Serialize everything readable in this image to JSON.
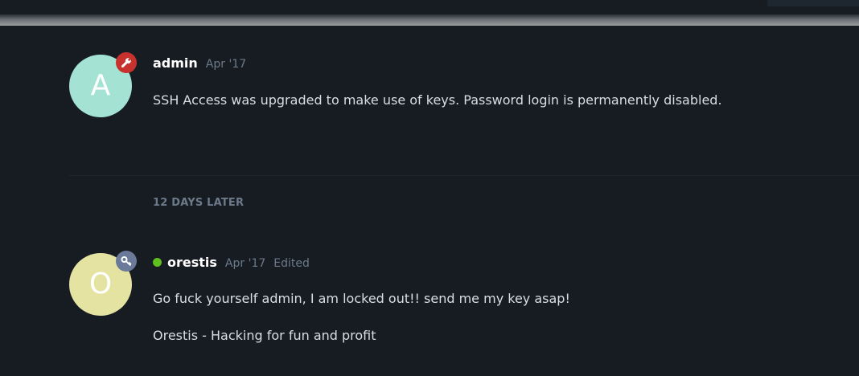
{
  "posts": [
    {
      "avatar_letter": "A",
      "avatar_color": "#a4e3d4",
      "badge_icon": "wrench-icon",
      "badge_color": "#c7322e",
      "username": "admin",
      "date": "Apr '17",
      "edited": "",
      "online": false,
      "body": [
        "SSH Access was upgraded to make use of keys. Password login is permanently disabled."
      ]
    },
    {
      "avatar_letter": "O",
      "avatar_color": "#e4e3a1",
      "badge_icon": "key-icon",
      "badge_color": "#6b7a99",
      "username": "orestis",
      "date": "Apr '17",
      "edited": "Edited",
      "online": true,
      "body": [
        "Go fuck yourself admin, I am locked out!! send me my key asap!",
        "Orestis - Hacking for fun and profit"
      ]
    }
  ],
  "time_gap": "12 DAYS LATER",
  "colors": {
    "background": "#171c22",
    "muted_text": "#6c7a8a",
    "online": "#5fbf1f"
  }
}
